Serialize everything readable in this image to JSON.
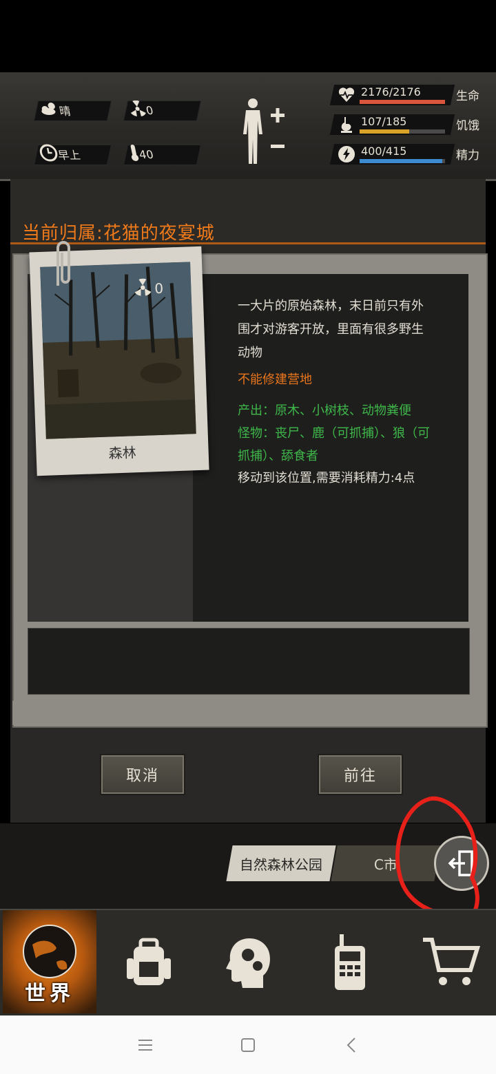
{
  "status": {
    "weather": {
      "icon": "cloud-sun-icon",
      "label": "晴"
    },
    "radiation": {
      "icon": "radiation-icon",
      "value": "0"
    },
    "time": {
      "icon": "clock-icon",
      "label": "早上"
    },
    "temperature": {
      "icon": "thermometer-icon",
      "value": "40"
    },
    "health": {
      "icon": "heart-icon",
      "value": "2176/2176",
      "label": "生命",
      "fraction": 1.0,
      "color": "#d9553b"
    },
    "hunger": {
      "icon": "stomach-icon",
      "value": "107/185",
      "label": "饥饿",
      "fraction": 0.578,
      "color": "#d9a229"
    },
    "energy": {
      "icon": "lightning-icon",
      "value": "400/415",
      "label": "精力",
      "fraction": 0.964,
      "color": "#3d8bd1"
    }
  },
  "panel": {
    "owner_title": "当前归属:花猫的夜宴城",
    "location_name": "森林",
    "location_radiation": "0",
    "description": "一大片的原始森林，末日前只有外围才对游客开放，里面有很多野生动物",
    "warning": "不能修建营地",
    "outputs": "产出：原木、小树枝、动物粪便",
    "monsters": "怪物：丧尸、鹿（可抓捕）、狼（可抓捕）、舔食者",
    "move_cost": "移动到该位置,需要消耗精力:4点"
  },
  "buttons": {
    "cancel": "取消",
    "go": "前往"
  },
  "breadcrumb": {
    "park": "自然森林公园",
    "city": "C市"
  },
  "nav": {
    "world": "世界"
  },
  "colors": {
    "accent_orange": "#f07a1a",
    "green_text": "#3fb84a",
    "annotation_red": "#e8201a"
  }
}
